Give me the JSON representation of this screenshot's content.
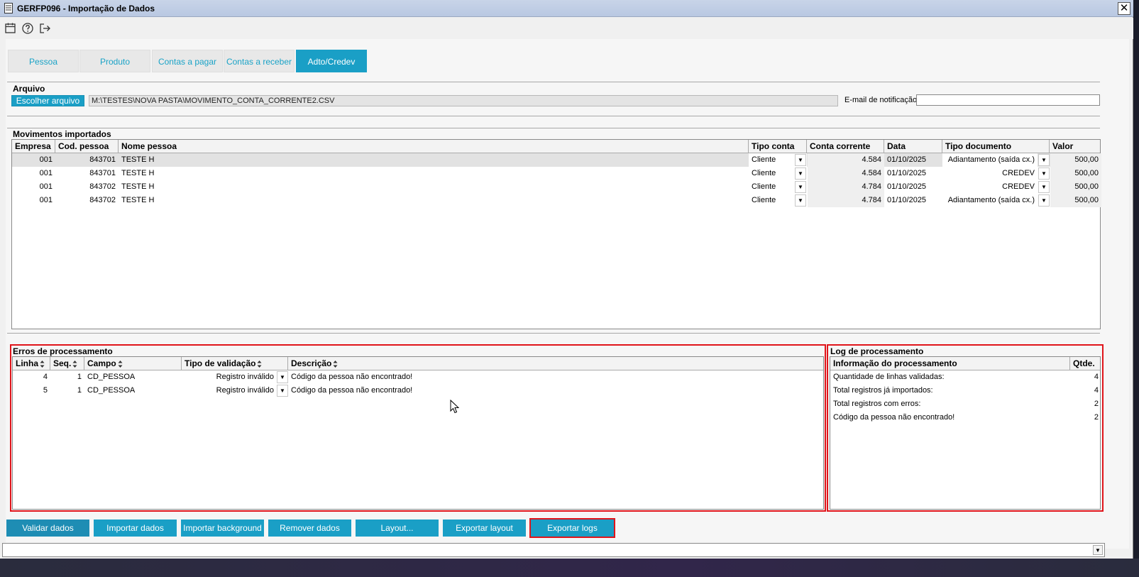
{
  "window": {
    "title": "GERFP096 - Importação de Dados",
    "close_label": "✕"
  },
  "tabs": [
    {
      "label": "Pessoa"
    },
    {
      "label": "Produto"
    },
    {
      "label": "Contas a pagar"
    },
    {
      "label": "Contas a receber"
    },
    {
      "label": "Adto/Credev",
      "active": true
    }
  ],
  "arquivo": {
    "section_label": "Arquivo",
    "choose_button": "Escolher arquivo",
    "file_path": "M:\\TESTES\\NOVA PASTA\\MOVIMENTO_CONTA_CORRENTE2.CSV",
    "email_label": "E-mail de notificação",
    "email_value": ""
  },
  "movimentos": {
    "section_label": "Movimentos importados",
    "columns": [
      "Empresa",
      "Cod. pessoa",
      "Nome pessoa",
      "Tipo conta",
      "Conta corrente",
      "Data",
      "Tipo documento",
      "Valor"
    ],
    "rows": [
      {
        "empresa": "001",
        "cod": "843701",
        "nome": "TESTE H",
        "tipo_conta": "Cliente",
        "conta": "4.584",
        "data": "01/10/2025",
        "tipo_doc": "Adiantamento (saída cx.)",
        "valor": "500,00"
      },
      {
        "empresa": "001",
        "cod": "843701",
        "nome": "TESTE H",
        "tipo_conta": "Cliente",
        "conta": "4.584",
        "data": "01/10/2025",
        "tipo_doc": "CREDEV",
        "valor": "500,00"
      },
      {
        "empresa": "001",
        "cod": "843702",
        "nome": "TESTE H",
        "tipo_conta": "Cliente",
        "conta": "4.784",
        "data": "01/10/2025",
        "tipo_doc": "CREDEV",
        "valor": "500,00"
      },
      {
        "empresa": "001",
        "cod": "843702",
        "nome": "TESTE H",
        "tipo_conta": "Cliente",
        "conta": "4.784",
        "data": "01/10/2025",
        "tipo_doc": "Adiantamento (saída cx.)",
        "valor": "500,00"
      }
    ]
  },
  "erros": {
    "section_label": "Erros de processamento",
    "columns": [
      "Linha",
      "Seq.",
      "Campo",
      "Tipo de validação",
      "Descrição"
    ],
    "rows": [
      {
        "linha": "4",
        "seq": "1",
        "campo": "CD_PESSOA",
        "tipo": "Registro inválido",
        "descricao": "Código da pessoa não encontrado!"
      },
      {
        "linha": "5",
        "seq": "1",
        "campo": "CD_PESSOA",
        "tipo": "Registro inválido",
        "descricao": "Código da pessoa não encontrado!"
      }
    ]
  },
  "log": {
    "section_label": "Log de processamento",
    "columns": [
      "Informação do processamento",
      "Qtde."
    ],
    "rows": [
      {
        "info": "Quantidade de linhas validadas:",
        "qtde": "4"
      },
      {
        "info": "Total registros já importados:",
        "qtde": "4"
      },
      {
        "info": "Total registros com erros:",
        "qtde": "2"
      },
      {
        "info": "Código da pessoa não encontrado!",
        "qtde": "2"
      }
    ]
  },
  "actions": [
    {
      "label": "Validar dados"
    },
    {
      "label": "Importar dados"
    },
    {
      "label": "Importar background"
    },
    {
      "label": "Remover dados"
    },
    {
      "label": "Layout..."
    },
    {
      "label": "Exportar layout"
    },
    {
      "label": "Exportar logs"
    }
  ],
  "colors": {
    "accent": "#1a9fc6",
    "highlight_frame": "#e0151b"
  }
}
